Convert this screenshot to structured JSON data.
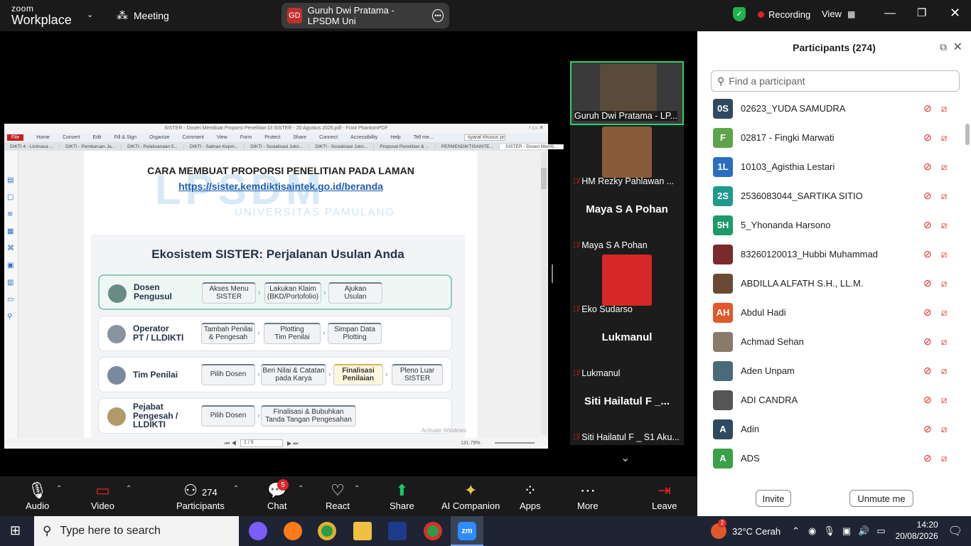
{
  "topbar": {
    "logo_line1": "zoom",
    "logo_line2": "Workplace",
    "meeting_label": "Meeting",
    "host_initials": "GD",
    "window_title": "Guruh Dwi Pratama - LPSDM Uni",
    "recording_label": "Recording",
    "view_label": "View"
  },
  "document": {
    "window_title": "SISTER - Dosen Membuat Proporsi Penelitian Di SISTER - 20 Agustus 2026.pdf - Foxit PhantomPDF",
    "menu": [
      "File",
      "Home",
      "Convert",
      "Edit",
      "Fill & Sign",
      "Organize",
      "Comment",
      "View",
      "Form",
      "Protect",
      "Share",
      "Connect",
      "Accessibility",
      "Help",
      "Tell me..."
    ],
    "search_value": "syarat khusus pro",
    "tabs": [
      "DIKTI 4 - Linimasa ...",
      "DIKTI - Pembaruan Ja...",
      "DIKTI - Pelaksanaan 5...",
      "DIKTI - Salinan Kepm...",
      "DIKTI - Sosialisasi Jukn...",
      "DIKTI - Sosialisasi Jukn...",
      "Proposal Penelitian & ...",
      "PERMENDIKTISAINTE...",
      "SISTER - Dosen Memb..."
    ],
    "page_title": "CARA MEMBUAT PROPORSI PENELITIAN PADA LAMAN",
    "page_link": "https://sister.kemdiktisaintek.go.id/beranda",
    "watermark": "LPSDM",
    "watermark_sub": "UNIVERSITAS PAMULANG",
    "infographic_title": "Ekosistem SISTER: Perjalanan Usulan Anda",
    "rows": [
      {
        "role": "Dosen\nPengusul",
        "steps": [
          "Akses Menu\nSISTER",
          "Lakukan Klaim\n(BKD/Portofolio)",
          "Ajukan\nUsulan"
        ]
      },
      {
        "role": "Operator\nPT / LLDIKTI",
        "steps": [
          "Tambah Penilai\n& Pengesah",
          "Plotting\nTim Penilai",
          "Simpan Data\nPlotting"
        ]
      },
      {
        "role": "Tim Penilai",
        "steps": [
          "Pilih Dosen",
          "Beri Nilai & Catatan\npada Karya",
          "Finalisasi\nPenilaian",
          "Pleno Luar\nSISTER"
        ]
      },
      {
        "role": "Pejabat\nPengesah /\nLLDIKTI",
        "steps": [
          "Pilih Dosen",
          "Finalisasi & Bubuhkan\nTanda Tangan Pengesahan"
        ]
      }
    ],
    "activate_text": "Activate Windows",
    "page_indicator": "1 / 6",
    "zoom_level": "131.79%"
  },
  "gallery": {
    "tiles": [
      {
        "name": "Guruh Dwi Pratama - LP...",
        "big": ""
      },
      {
        "name": "HM Rezky Pahlawan ...",
        "big": ""
      },
      {
        "name": "Maya  S A Pohan",
        "big": "Maya  S A Pohan"
      },
      {
        "name": "Eko Sudarso",
        "big": ""
      },
      {
        "name": "Lukmanul",
        "big": "Lukmanul"
      },
      {
        "name": "Siti Hailatul F _ S1 Aku...",
        "big": "Siti Hailatul F _..."
      }
    ]
  },
  "participants": {
    "title": "Participants (274)",
    "search_placeholder": "Find a participant",
    "items": [
      {
        "initials": "0S",
        "color": "#2f4a5f",
        "name": "02623_YUDA SAMUDRA"
      },
      {
        "initials": "F",
        "color": "#5ea34a",
        "name": "02817 - Fingki Marwati"
      },
      {
        "initials": "1L",
        "color": "#2a6fbf",
        "name": "10103_Agisthia Lestari"
      },
      {
        "initials": "2S",
        "color": "#1e9a8a",
        "name": "2536083044_SARTIKA SITIO"
      },
      {
        "initials": "5H",
        "color": "#1e9a6a",
        "name": "5_Yhonanda Harsono"
      },
      {
        "initials": "",
        "color": "#7a2a2a",
        "name": "83260120013_Hubbi Muhammad"
      },
      {
        "initials": "",
        "color": "#6b4a35",
        "name": "ABDILLA ALFATH S.H., LL.M."
      },
      {
        "initials": "AH",
        "color": "#e0582b",
        "name": "Abdul Hadi"
      },
      {
        "initials": "",
        "color": "#8a7a6a",
        "name": "Achmad Sehan"
      },
      {
        "initials": "",
        "color": "#4a6a7a",
        "name": "Aden Unpam"
      },
      {
        "initials": "",
        "color": "#555555",
        "name": "ADI CANDRA"
      },
      {
        "initials": "A",
        "color": "#2f4a5f",
        "name": "Adin"
      },
      {
        "initials": "A",
        "color": "#3aa04a",
        "name": "ADS"
      }
    ],
    "invite_label": "Invite",
    "unmute_label": "Unmute me"
  },
  "toolbar": {
    "audio": "Audio",
    "video": "Video",
    "participants": "Participants",
    "participants_count": "274",
    "chat": "Chat",
    "chat_badge": "5",
    "react": "React",
    "share": "Share",
    "companion": "AI Companion",
    "apps": "Apps",
    "more": "More",
    "leave": "Leave"
  },
  "taskbar": {
    "search_placeholder": "Type here to search",
    "weather_badge": "2",
    "weather": "32°C  Cerah",
    "time": "14:20",
    "date": "20/08/2026"
  }
}
